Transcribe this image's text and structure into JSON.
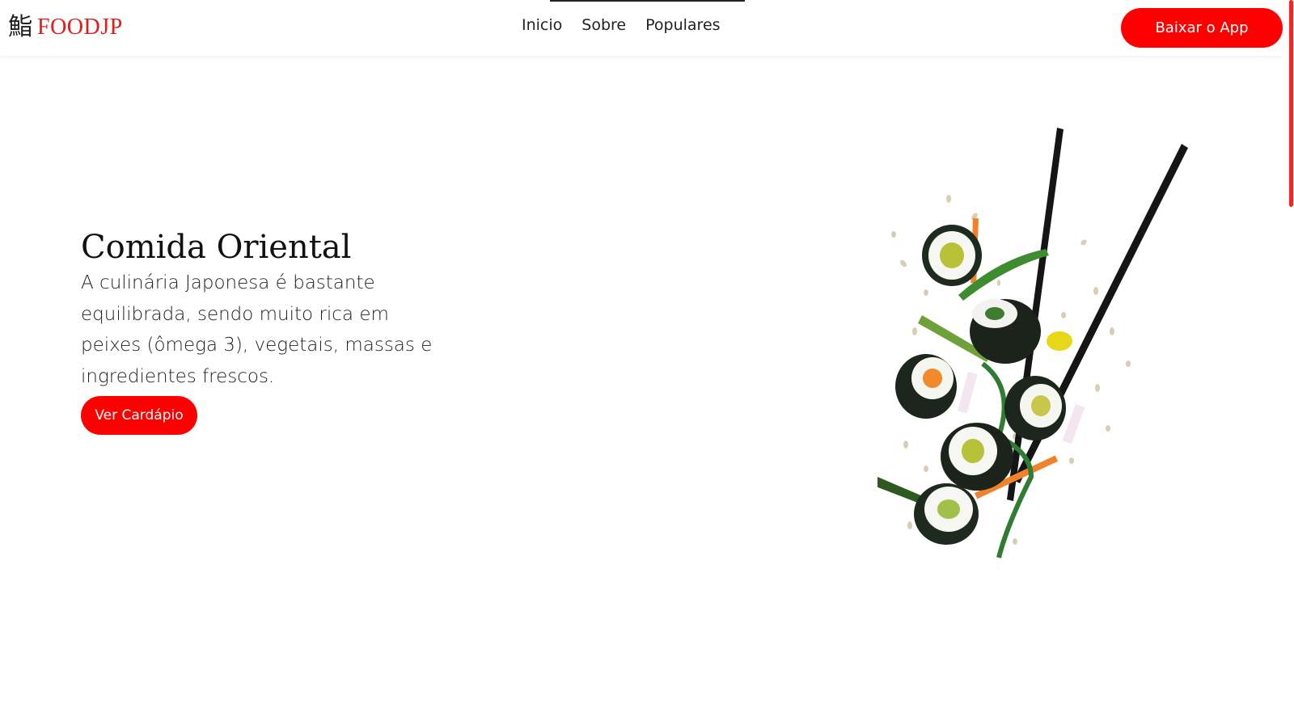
{
  "header": {
    "logo_kanji": "鮨",
    "logo_text": "FOODJP",
    "nav": {
      "items": [
        {
          "label": "Inicio"
        },
        {
          "label": "Sobre"
        },
        {
          "label": "Populares"
        }
      ]
    },
    "download_button_label": "Baixar o App"
  },
  "hero": {
    "title": "Comida Oriental",
    "description": "A culinária Japonesa é bastante equilibrada, sendo muito rica em peixes (ômega 3), vegetais, massas e ingredientes frescos.",
    "menu_button_label": "Ver Cardápio",
    "image_icon": "sushi-chopsticks-illustration"
  },
  "colors": {
    "accent": "#ff0000",
    "logo": "#e31b1b",
    "text": "#111111",
    "background": "#ffffff"
  }
}
